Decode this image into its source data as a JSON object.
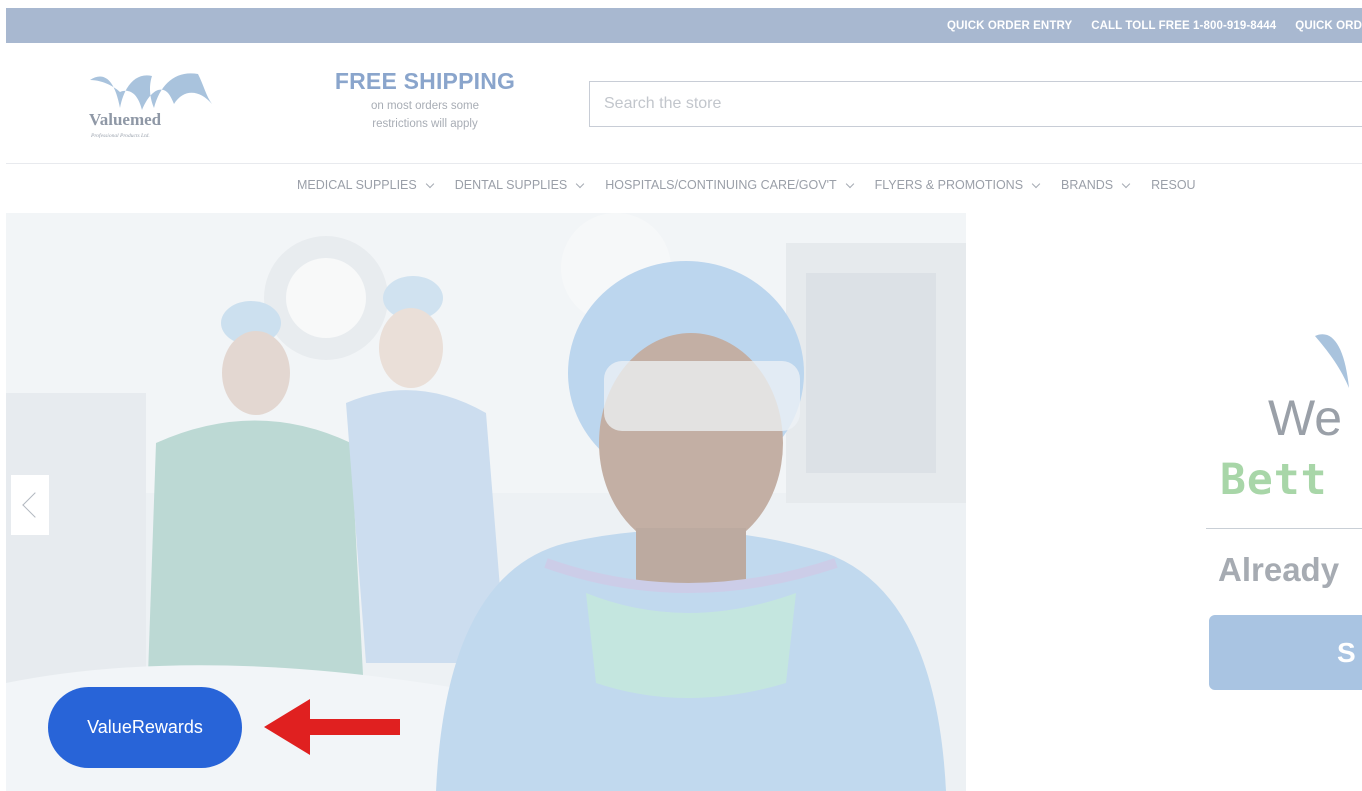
{
  "topbar": {
    "links": [
      "QUICK ORDER ENTRY",
      "CALL TOLL FREE 1-800-919-8444",
      "QUICK ORD"
    ]
  },
  "logo": {
    "name": "Valuemed",
    "tagline": "Professional Products Ltd."
  },
  "shipping": {
    "title": "FREE SHIPPING",
    "line1": "on most orders some",
    "line2": "restrictions will apply"
  },
  "search": {
    "placeholder": "Search the store"
  },
  "nav": {
    "items": [
      {
        "label": "MEDICAL SUPPLIES"
      },
      {
        "label": "DENTAL SUPPLIES"
      },
      {
        "label": "HOSPITALS/CONTINUING CARE/GOV'T"
      },
      {
        "label": "FLYERS & PROMOTIONS"
      },
      {
        "label": "BRANDS"
      },
      {
        "label": "RESOU"
      }
    ]
  },
  "welcome": {
    "title": "We",
    "subtitle": "Bett",
    "question": "Already",
    "button": "S"
  },
  "rewards": {
    "label": "ValueRewards"
  },
  "colors": {
    "topbar": "#a8b8d0",
    "accent": "#8aa5cc",
    "rewards": "#2864d8",
    "arrow": "#e02020",
    "green": "#a8d6a8"
  },
  "icons": {
    "prev": "chevron-left-icon",
    "nav": "chevron-down-icon",
    "arrow": "arrow-left-icon"
  }
}
